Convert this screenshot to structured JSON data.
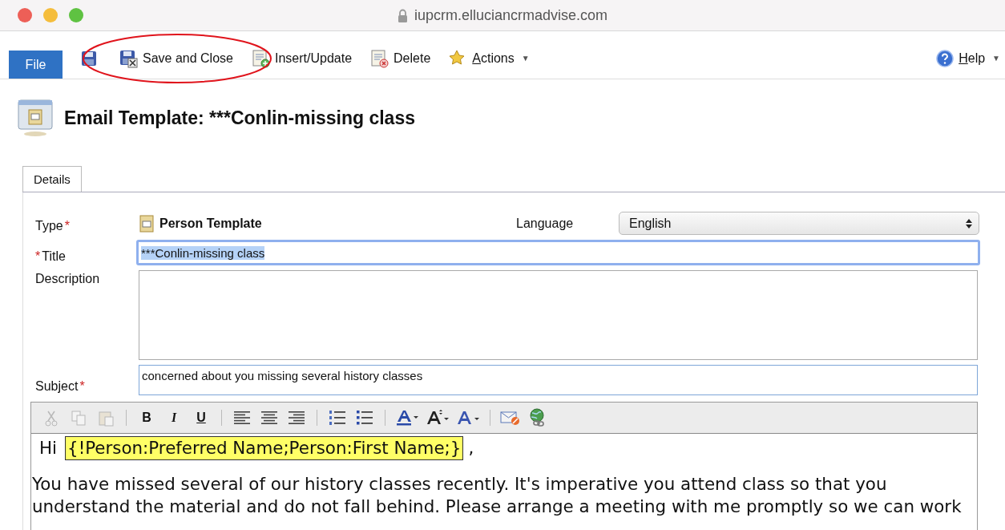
{
  "browser": {
    "url": "iupcrm.elluciancrmadvise.com"
  },
  "toolbar": {
    "file": "File",
    "buttons": [
      {
        "label": "Save and Close",
        "access_key": false
      },
      {
        "label": "Insert/Update",
        "access_key": false
      },
      {
        "label": "Delete",
        "access_key": false
      },
      {
        "label": "Actions",
        "caret": "▼",
        "access_key": true
      }
    ],
    "help": {
      "label": "Help",
      "caret": "▼",
      "access_key": true
    }
  },
  "header": {
    "title": "Email Template: ***Conlin-missing class"
  },
  "tabs": [
    {
      "label": "Details",
      "selected": true
    }
  ],
  "form": {
    "type": {
      "label": "Type",
      "required_after": "*",
      "value": "Person Template"
    },
    "language": {
      "label": "Language",
      "value": "English"
    },
    "title": {
      "required_before": "*",
      "label": "Title",
      "value": "***Conlin-missing class",
      "focused": true,
      "text_selected": true
    },
    "description": {
      "label": "Description"
    },
    "subject": {
      "label": "Subject",
      "required_after": "*",
      "value": "concerned about you missing several history classes",
      "focused": false
    }
  },
  "editor": {
    "clipboard": [
      {
        "disabled": true
      },
      {
        "disabled": true
      },
      {
        "disabled": true
      }
    ],
    "format_buttons": [
      "B",
      "I",
      "U"
    ],
    "greeting": "Hi",
    "merge_field": "{!Person:Preferred Name;Person:First Name;}",
    "after_field": ",",
    "paragraph": "You have missed several of our history classes recently. It's imperative you attend class so that you understand the material and do not fall behind. Please arrange a meeting with me promptly so we can work"
  }
}
